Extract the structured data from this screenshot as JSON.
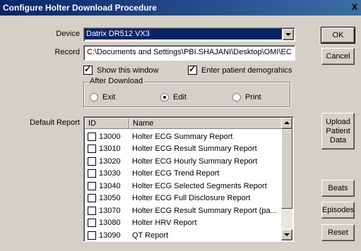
{
  "window": {
    "title": "Configure Holter Download Procedure",
    "close": "X"
  },
  "form": {
    "device_label": "Device",
    "device_value": "Datrix DR512 VX3",
    "record_label": "Record",
    "record_value": "C:\\Documents and Settings\\PBI.SHAJANI\\Desktop\\OMI\\ECG",
    "show_window_label": "Show this window",
    "show_window_checked": true,
    "enter_demographics_label": "Enter patient demograhics",
    "enter_demographics_checked": true
  },
  "after_download": {
    "legend": "After Download",
    "options": [
      "Exit",
      "Edit",
      "Print"
    ],
    "selected": "Edit"
  },
  "report": {
    "label": "Default Report",
    "columns": [
      "ID",
      "Name"
    ],
    "rows": [
      {
        "id": "13000",
        "name": "Holter ECG Summary Report",
        "checked": false
      },
      {
        "id": "13010",
        "name": "Holter ECG Result Summary Report",
        "checked": false
      },
      {
        "id": "13020",
        "name": "Holter ECG Hourly Summary Report",
        "checked": false
      },
      {
        "id": "13030",
        "name": "Holter ECG Trend Report",
        "checked": false
      },
      {
        "id": "13040",
        "name": "Holter ECG Selected Segments Report",
        "checked": false
      },
      {
        "id": "13050",
        "name": "Holter ECG Full Disclosure Report",
        "checked": false
      },
      {
        "id": "13070",
        "name": "Holter ECG Result Summary Report (pa...",
        "checked": false
      },
      {
        "id": "13080",
        "name": "Holter HRV Report",
        "checked": false
      },
      {
        "id": "13090",
        "name": "QT Report",
        "checked": false
      }
    ]
  },
  "buttons": {
    "ok": "OK",
    "cancel": "Cancel",
    "upload_line1": "Upload",
    "upload_line2": "Patient",
    "upload_line3": "Data",
    "beats": "Beats",
    "episodes": "Episodes",
    "reset": "Reset"
  }
}
